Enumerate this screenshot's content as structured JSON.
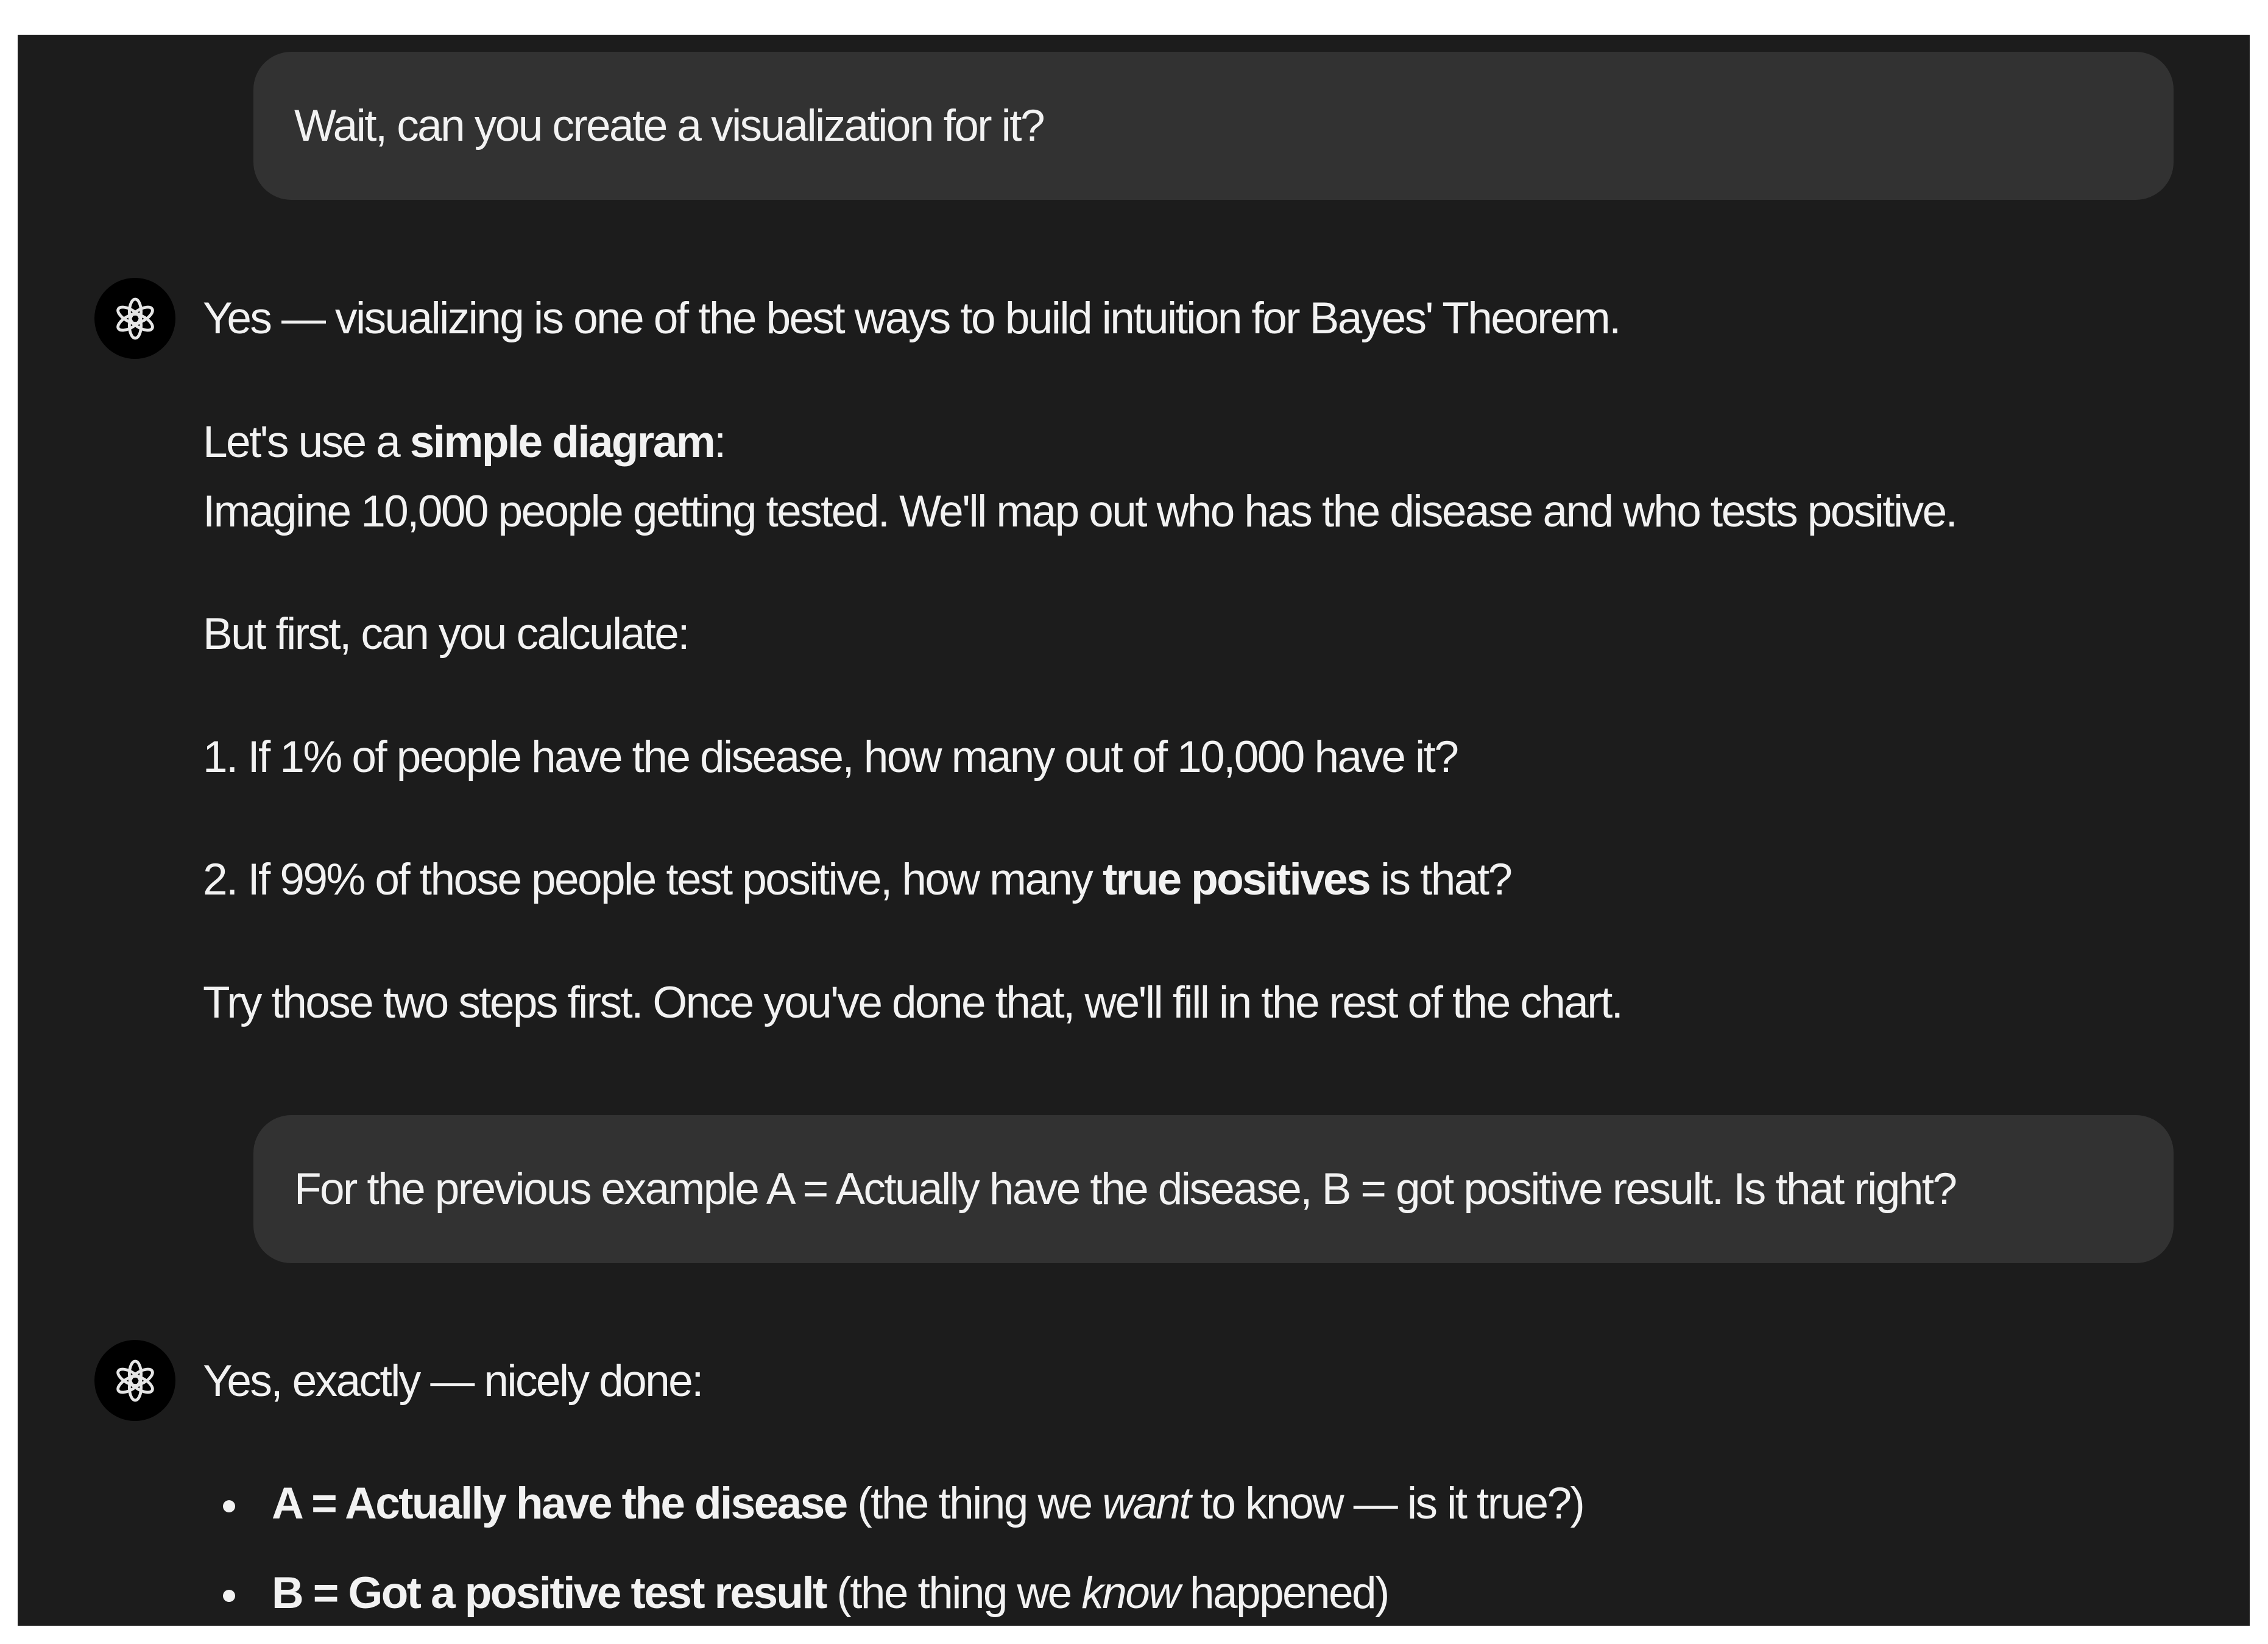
{
  "conversation": {
    "user_message_1": "Wait, can you create a visualization for it?",
    "assistant_message_1": {
      "line1": "Yes — visualizing is one of the best ways to build intuition for Bayes' Theorem.",
      "line2_prefix": "Let's use a ",
      "line2_bold": "simple diagram",
      "line2_suffix": ":",
      "line3": "Imagine 10,000 people getting tested. We'll map out who has the disease and who tests positive.",
      "line4": "But first, can you calculate:",
      "step1": "1. If 1% of people have the disease, how many out of 10,000 have it?",
      "step2_prefix": "2. If 99% of those people test positive, how many ",
      "step2_bold": "true positives",
      "step2_suffix": " is that?",
      "closing": "Try those two steps first. Once you've done that, we'll fill in the rest of the chart."
    },
    "user_message_2": "For the previous example A = Actually have the disease, B = got positive result. Is that right?",
    "assistant_message_2": {
      "intro": "Yes, exactly — nicely done:",
      "bullet1_bold": "A = Actually have the disease",
      "bullet1_pre": " (the thing we ",
      "bullet1_italic": "want",
      "bullet1_post": " to know — is it true?)",
      "bullet2_bold": "B = Got a positive test result",
      "bullet2_pre": " (the thing we ",
      "bullet2_italic": "know",
      "bullet2_post": " happened)"
    }
  },
  "icons": {
    "assistant_avatar": "openai-logo-icon"
  },
  "colors": {
    "background": "#1c1c1c",
    "user_bubble": "#323232",
    "text": "#f2f2f2",
    "avatar_bg": "#000000"
  }
}
